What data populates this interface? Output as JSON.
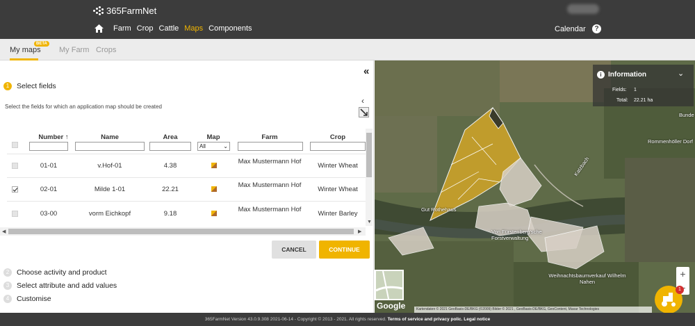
{
  "app": {
    "logo": "365FarmNet"
  },
  "nav": {
    "items": [
      {
        "label": "Farm",
        "active": false
      },
      {
        "label": "Crop",
        "active": false
      },
      {
        "label": "Cattle",
        "active": false
      },
      {
        "label": "Maps",
        "active": true
      },
      {
        "label": "Components",
        "active": false
      }
    ],
    "calendar": "Calendar",
    "help": "?"
  },
  "subtabs": {
    "items": [
      {
        "label": "My maps",
        "active": true
      },
      {
        "label": "My Farm",
        "active": false
      },
      {
        "label": "Crops",
        "active": false
      }
    ],
    "beta": "BETA"
  },
  "panel": {
    "collapse": "«",
    "steps": [
      {
        "num": "1",
        "label": "Select fields",
        "active": true
      },
      {
        "num": "2",
        "label": "Choose activity and product",
        "active": false
      },
      {
        "num": "3",
        "label": "Select attribute and add values",
        "active": false
      },
      {
        "num": "4",
        "label": "Customise",
        "active": false
      }
    ],
    "instruction": "Select the fields for which an application map should be created",
    "table": {
      "columns": [
        "Number ↑",
        "Name",
        "Area",
        "Map",
        "Farm",
        "Crop"
      ],
      "map_filter": "All",
      "rows": [
        {
          "checked": false,
          "number": "01-01",
          "name": "v.Hof-01",
          "area": "4.38",
          "farm": "Max Mustermann Hof",
          "crop": "Winter Wheat"
        },
        {
          "checked": true,
          "number": "02-01",
          "name": "Milde 1-01",
          "area": "22.21",
          "farm": "Max Mustermann Hof",
          "crop": "Winter Wheat"
        },
        {
          "checked": false,
          "number": "03-00",
          "name": "vorm Eichkopf",
          "area": "9.18",
          "farm": "Max Mustermann Hof",
          "crop": "Winter Barley"
        }
      ]
    },
    "buttons": {
      "cancel": "CANCEL",
      "continue": "CONTINUE"
    }
  },
  "map": {
    "info": {
      "title": "Information",
      "fields_label": "Fields:",
      "fields_value": "1",
      "total_label": "Total:",
      "total_value": "22.21 ha"
    },
    "labels": [
      "Gut Rothehaus",
      "Von Fürstenberg'sche Forstverwaltung",
      "Weihnachtsbaumverkauf Wilhelm Nahen",
      "Rommenhöller Dorf",
      "Katzbach",
      "Bunde"
    ],
    "zoom_in": "+",
    "google": "Google",
    "attribution": "Kartendaten © 2021 GeoBasis-DE/BKG (©2009) Bilder © 2021 , GeoBasis-DE/BKG, GeoContent, Maxar Technologies",
    "fab_badge": "1",
    "colors": {
      "selected_field": "#c9a12a",
      "other_field": "#d8d0c6"
    }
  },
  "footer": {
    "text": "365FarmNet Version 43.0.9.308 2021-06-14 - Copyright © 2013 - 2021. All rights reserved.",
    "links": "Terms of service and privacy polic. Legal notice"
  }
}
